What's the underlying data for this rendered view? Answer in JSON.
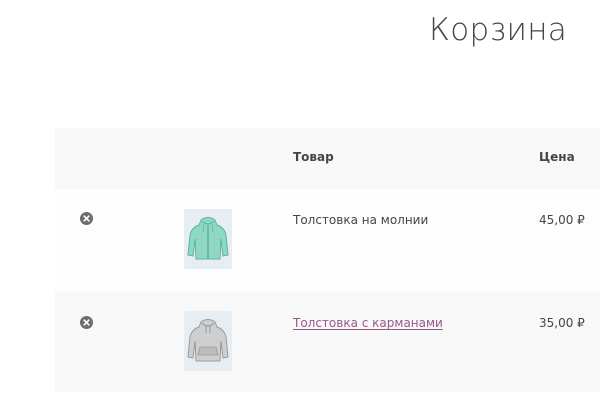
{
  "page": {
    "title": "Корзина"
  },
  "table": {
    "headers": {
      "remove": "",
      "thumbnail": "",
      "product": "Товар",
      "price": "Цена"
    },
    "items": [
      {
        "name": "Толстовка на молнии",
        "price": "45,00 ₽",
        "is_link": false,
        "thumbnail_icon": "zip-hoodie-icon",
        "thumbnail_color": "#8fd8c4"
      },
      {
        "name": "Толстовка с карманами",
        "price": "35,00 ₽",
        "is_link": true,
        "thumbnail_icon": "pocket-hoodie-icon",
        "thumbnail_color": "#c9c9c9"
      }
    ]
  },
  "colors": {
    "link": "#96588a",
    "text": "#43454b",
    "remove_icon": "#6d6d6d"
  }
}
